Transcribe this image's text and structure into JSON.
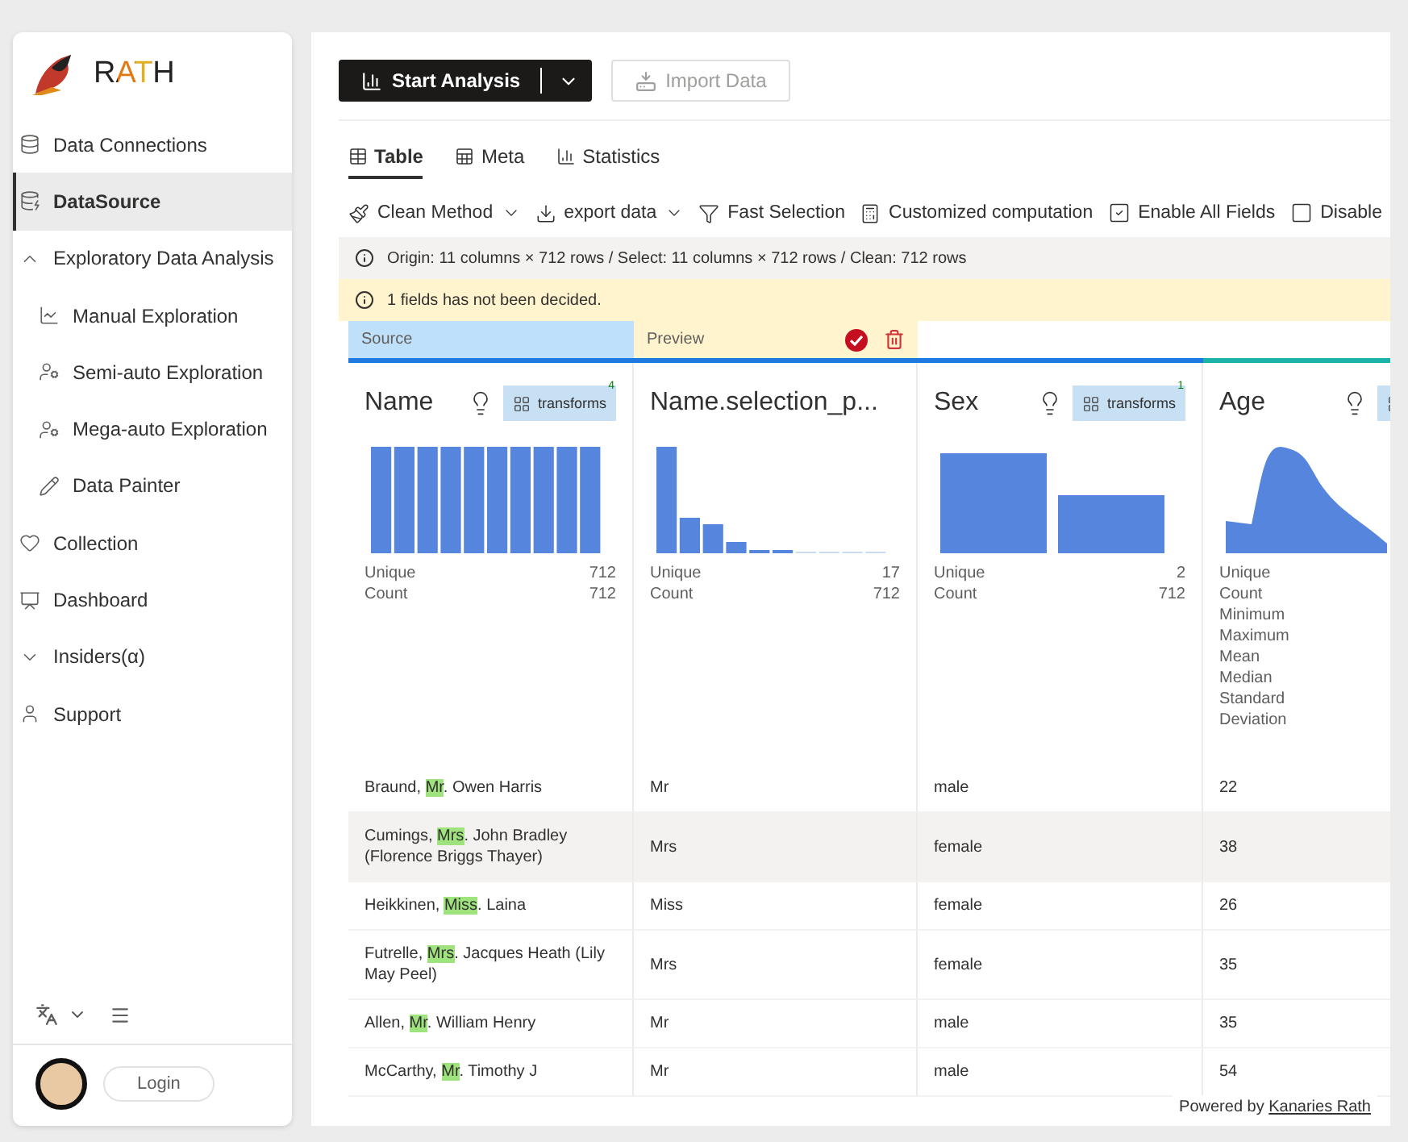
{
  "app": {
    "name": "RATH"
  },
  "sidebar": {
    "items": [
      {
        "kind": "item",
        "label": "Data Connections",
        "selected": false
      },
      {
        "kind": "item",
        "label": "DataSource",
        "selected": true
      },
      {
        "kind": "group",
        "label": "Exploratory Data Analysis",
        "expanded": true,
        "children": [
          {
            "label": "Manual Exploration",
            "selected": false
          },
          {
            "label": "Semi-auto Exploration",
            "selected": false
          },
          {
            "label": "Mega-auto Exploration",
            "selected": false
          },
          {
            "label": "Data Painter",
            "selected": false
          }
        ]
      },
      {
        "kind": "item",
        "label": "Collection",
        "selected": false
      },
      {
        "kind": "item",
        "label": "Dashboard",
        "selected": false
      },
      {
        "kind": "group",
        "label": "Insiders(α)",
        "expanded": false
      },
      {
        "kind": "item",
        "label": "Support",
        "selected": false
      }
    ],
    "login": "Login"
  },
  "actions": {
    "start": "Start Analysis",
    "import": "Import Data"
  },
  "tabs": [
    {
      "label": "Table",
      "selected": true
    },
    {
      "label": "Meta",
      "selected": false
    },
    {
      "label": "Statistics",
      "selected": false
    }
  ],
  "toolbar": [
    {
      "kind": "menu",
      "label": "Clean Method"
    },
    {
      "kind": "menu",
      "label": "export data"
    },
    {
      "kind": "button",
      "label": "Fast Selection"
    },
    {
      "kind": "button",
      "label": "Customized computation"
    },
    {
      "kind": "checkbox",
      "label": "Enable All Fields",
      "checked": true
    },
    {
      "kind": "checkbox",
      "label": "Disable",
      "checked": false
    }
  ],
  "info": "Origin: 11 columns × 712 rows / Select: 11 columns × 712 rows / Clean: 712 rows",
  "warning": "1 fields has not been decided.",
  "columns": [
    {
      "kind": "source",
      "strip_label": "Source",
      "color": "#1e7ae0",
      "name": "Name",
      "transforms": "transforms",
      "transforms_count": "4",
      "stats": [
        {
          "label": "Unique",
          "value": "712"
        },
        {
          "label": "Count",
          "value": "712"
        }
      ]
    },
    {
      "kind": "preview",
      "strip_label": "Preview",
      "color": "#1e7ae0",
      "name": "Name.selection_p...",
      "stats": [
        {
          "label": "Unique",
          "value": "17"
        },
        {
          "label": "Count",
          "value": "712"
        }
      ]
    },
    {
      "kind": "plain",
      "color": "#1e7ae0",
      "name": "Sex",
      "transforms": "transforms",
      "transforms_count": "1",
      "stats": [
        {
          "label": "Unique",
          "value": "2"
        },
        {
          "label": "Count",
          "value": "712"
        }
      ]
    },
    {
      "kind": "plain",
      "color": "#1bb3a8",
      "name": "Age",
      "transforms_cut": true,
      "stats": [
        {
          "label": "Unique"
        },
        {
          "label": "Count"
        },
        {
          "label": "Minimum"
        },
        {
          "label": "Maximum"
        },
        {
          "label": "Mean"
        },
        {
          "label": "Median"
        },
        {
          "label": "Standard Deviation"
        }
      ]
    }
  ],
  "rows": [
    {
      "selected": false,
      "name": {
        "before": "Braund, ",
        "match": "Mr",
        "after": ". Owen Harris"
      },
      "title": "Mr",
      "sex": "male",
      "age": "22"
    },
    {
      "selected": true,
      "name": {
        "before": "Cumings, ",
        "match": "Mrs",
        "after": ". John Bradley (Florence Briggs Thayer)"
      },
      "title": "Mrs",
      "sex": "female",
      "age": "38"
    },
    {
      "selected": false,
      "name": {
        "before": "Heikkinen, ",
        "match": "Miss",
        "after": ". Laina"
      },
      "title": "Miss",
      "sex": "female",
      "age": "26"
    },
    {
      "selected": false,
      "name": {
        "before": "Futrelle, ",
        "match": "Mrs",
        "after": ". Jacques Heath (Lily May Peel)"
      },
      "title": "Mrs",
      "sex": "female",
      "age": "35"
    },
    {
      "selected": false,
      "name": {
        "before": "Allen, ",
        "match": "Mr",
        "after": ". William Henry"
      },
      "title": "Mr",
      "sex": "male",
      "age": "35"
    },
    {
      "selected": false,
      "name": {
        "before": "McCarthy, ",
        "match": "Mr",
        "after": ". Timothy J"
      },
      "title": "Mr",
      "sex": "male",
      "age": "54"
    }
  ],
  "footer": {
    "text": "Powered by",
    "link": "Kanaries Rath"
  }
}
